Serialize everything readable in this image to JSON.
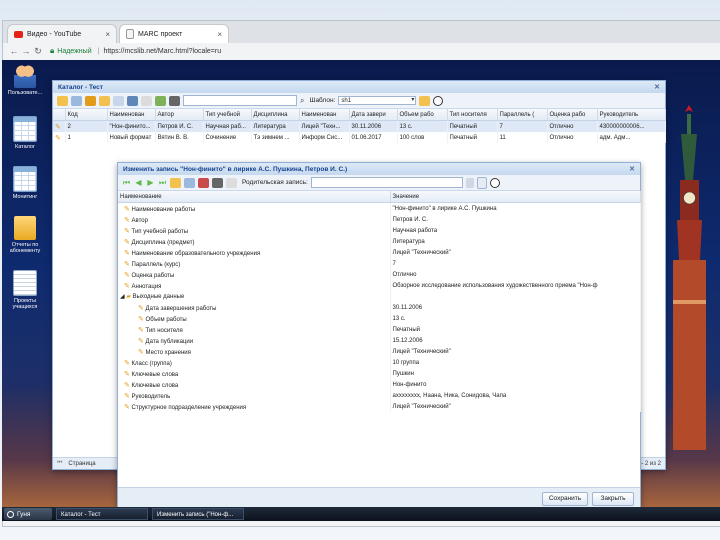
{
  "browser": {
    "tabs": [
      {
        "label": "Видео - YouTube",
        "icon": "youtube-icon"
      },
      {
        "label": "MARC проект",
        "icon": "document-icon"
      }
    ],
    "secure_label": "Надежный",
    "url": "https://mcslib.net/Marc.html?locale=ru"
  },
  "desktop": {
    "icons": [
      {
        "label": "Пользовате...",
        "icon": "users-icon"
      },
      {
        "label": "Каталог",
        "icon": "table-icon"
      },
      {
        "label": "Монитинг",
        "icon": "table-icon"
      },
      {
        "label": "Отчеты по абонементу",
        "icon": "folder-icon"
      },
      {
        "label": "Проекты учащихся",
        "icon": "document-icon"
      }
    ]
  },
  "catalog": {
    "title": "Каталог - Тест",
    "template_label": "Шаблон:",
    "template_value": "sh1",
    "columns": [
      "Код",
      "Наименован",
      "Автор",
      "Тип учебной",
      "Дисциплина",
      "Наименован",
      "Дата завери",
      "Объем рабо",
      "Тип носителя",
      "Параллель (",
      "Оценка рабо",
      "Руководитель"
    ],
    "rows": [
      [
        "2",
        "\"Нон-финито...",
        "Петров И. С.",
        "Научная раб...",
        "Литература",
        "Лицей \"Техн...",
        "30.11.2006",
        "13 с.",
        "Печатный",
        "7",
        "Отлично",
        "430000000006..."
      ],
      [
        "1",
        "Новый формат",
        "Вятин В. В.",
        "Сочинение",
        "Тэ зимнем ...",
        "Информ Сис...",
        "01.06.2017",
        "100 слов",
        "Печатный",
        "11",
        "Отлично",
        "адм. Адм..."
      ]
    ],
    "paging_label": "Страница",
    "paging_count": "- 2 из 2"
  },
  "dialog": {
    "title": "Изменить запись \"Нон-финито\" в лирике А.С. Пушкина, Петров И. С.)",
    "parent_label": "Родительская запись:",
    "col_name": "Наименование",
    "col_value": "Значение",
    "rows": [
      {
        "name": "Наименование работы",
        "value": "\"Нон-финито\" в лирике А.С. Пушкина",
        "level": "item"
      },
      {
        "name": "Автор",
        "value": "Петров И. С.",
        "level": "item"
      },
      {
        "name": "Тип учебной работы",
        "value": "Научная работа",
        "level": "item"
      },
      {
        "name": "Дисциплина (предмет)",
        "value": "Литература",
        "level": "item"
      },
      {
        "name": "Наименование образовательного учреждения",
        "value": "Лицей \"Технический\"",
        "level": "item"
      },
      {
        "name": "Параллель (курс)",
        "value": "7",
        "level": "item"
      },
      {
        "name": "Оценка работы",
        "value": "Отлично",
        "level": "item"
      },
      {
        "name": "Аннотация",
        "value": "Обзорное исследование использования художественного приема \"Нон-ф",
        "level": "item"
      },
      {
        "name": "Выходные данные",
        "value": "",
        "level": "group"
      },
      {
        "name": "Дата завершения работы",
        "value": "30.11.2006",
        "level": "child"
      },
      {
        "name": "Объем работы",
        "value": "13 с.",
        "level": "child"
      },
      {
        "name": "Тип носителя",
        "value": "Печатный",
        "level": "child"
      },
      {
        "name": "Дата публикации",
        "value": "15.12.2006",
        "level": "child"
      },
      {
        "name": "Место хранения",
        "value": "Лицей \"Технический\"",
        "level": "child"
      },
      {
        "name": "Класс (группа)",
        "value": "10 группа",
        "level": "item"
      },
      {
        "name": "Ключевые слова",
        "value": "Пушкин",
        "level": "item"
      },
      {
        "name": "Ключевые слова",
        "value": "Нон-финито",
        "level": "item"
      },
      {
        "name": "Руководитель",
        "value": "ахххххххх, Наана, Ника, Сонидова, Чапа",
        "level": "item"
      },
      {
        "name": "Структурное подразделение учреждения",
        "value": "Лицей \"Технический\"",
        "level": "item"
      }
    ],
    "save_label": "Сохранить",
    "close_label": "Закрыть"
  },
  "taskbar": {
    "start_label": "Гуня",
    "tasks": [
      "Каталог - Тест",
      "Изменить запись (\"Нон-ф..."
    ]
  },
  "colors": {
    "accent": "#15428b",
    "desktop_bg": "#0e2a6e",
    "pencil": "#e39b1a"
  }
}
